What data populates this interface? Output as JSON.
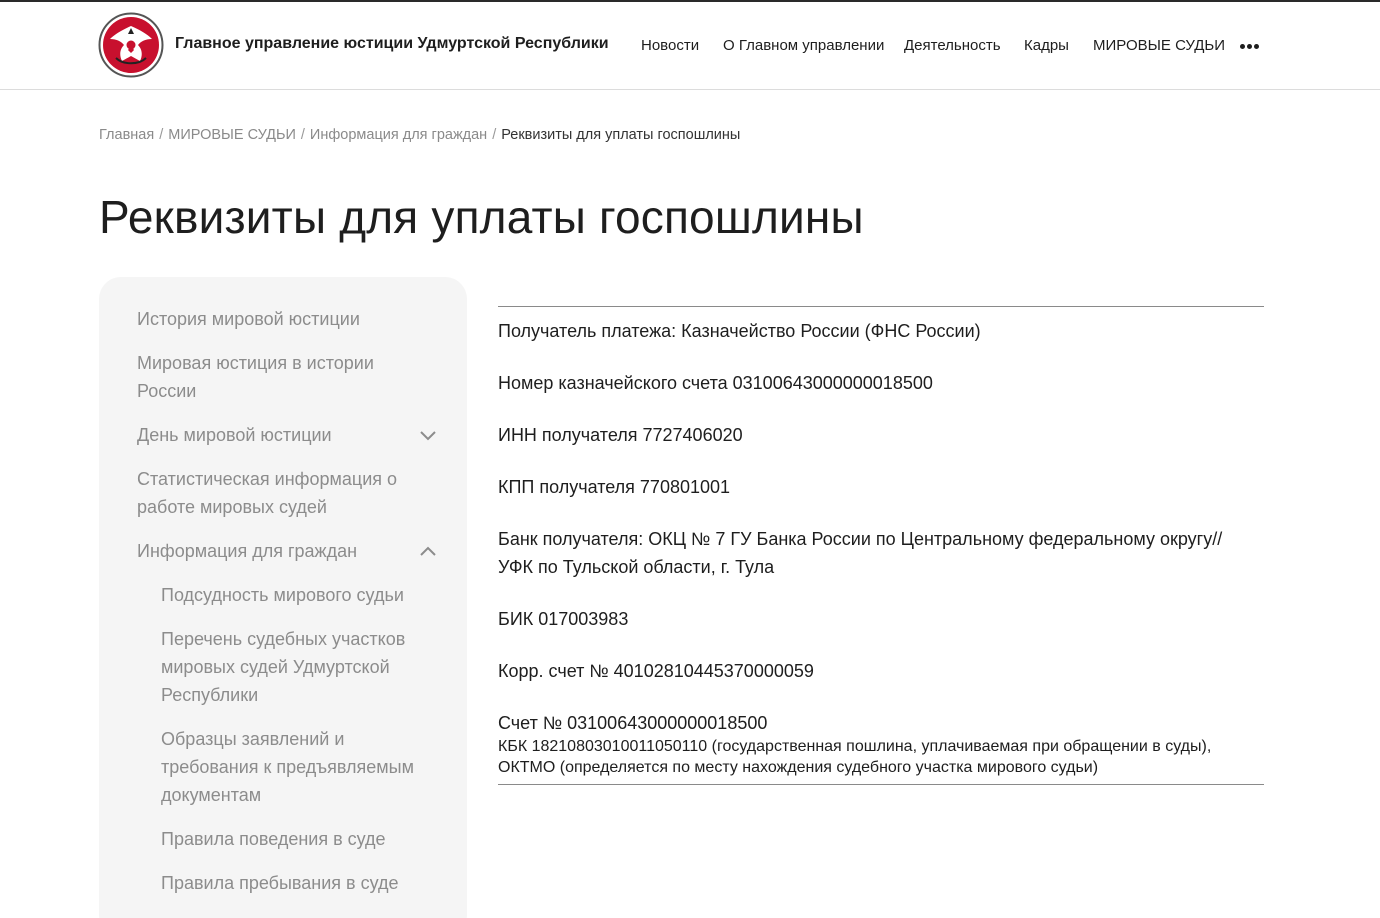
{
  "header": {
    "site_title": "Главное управление юстиции Удмуртской Республики",
    "logo_icon": "udmurtia-coat-of-arms-icon",
    "nav": [
      {
        "label": "Новости"
      },
      {
        "label": "О Главном управлении"
      },
      {
        "label": "Деятельность"
      },
      {
        "label": "Кадры"
      },
      {
        "label": "МИРОВЫЕ СУДЬИ"
      }
    ],
    "more_icon": "more-horizontal-icon"
  },
  "breadcrumb": {
    "items": [
      "Главная",
      "МИРОВЫЕ СУДЬИ",
      "Информация для граждан"
    ],
    "current": "Реквизиты для уплаты госпошлины",
    "separator": "/"
  },
  "page_title": "Реквизиты для уплаты госпошлины",
  "sidebar": {
    "items": [
      {
        "label": "История мировой юстиции"
      },
      {
        "label": "Мировая юстиция в истории России"
      },
      {
        "label": "День мировой юстиции",
        "icon": "chevron-down-icon"
      },
      {
        "label": "Статистическая информация о работе мировых судей"
      },
      {
        "label": "Информация для граждан",
        "icon": "chevron-up-icon"
      }
    ],
    "subitems": [
      {
        "label": "Подсудность мирового судьи"
      },
      {
        "label": "Перечень судебных участков мировых судей Удмуртской Республики"
      },
      {
        "label": "Образцы заявлений и требования к предъявляемым документам"
      },
      {
        "label": "Правила поведения в суде"
      },
      {
        "label": "Правила пребывания в суде"
      }
    ]
  },
  "content": {
    "recipient": "Получатель платежа: Казначейство России (ФНС России)",
    "treasury_account": "Номер казначейского счета 03100643000000018500",
    "inn": "ИНН получателя 7727406020",
    "kpp": "КПП получателя 770801001",
    "bank": "Банк получателя: ОКЦ № 7 ГУ Банка России по Центральному федеральному округу// УФК по Тульской области, г. Тула",
    "bik": "БИК 017003983",
    "corr_account": "Корр. счет № 40102810445370000059",
    "account": "Счет № 03100643000000018500",
    "kbk": "КБК 18210803010011050110 (государственная пошлина, уплачиваемая при обращении в суды),",
    "oktmo": "ОКТМО (определяется по месту нахождения судебного участка мирового судьи)"
  },
  "colors": {
    "text": "#1e1e1e",
    "muted": "#8c8c8c",
    "sidebar_bg": "#f5f5f5",
    "logo_red": "#c8102e"
  }
}
